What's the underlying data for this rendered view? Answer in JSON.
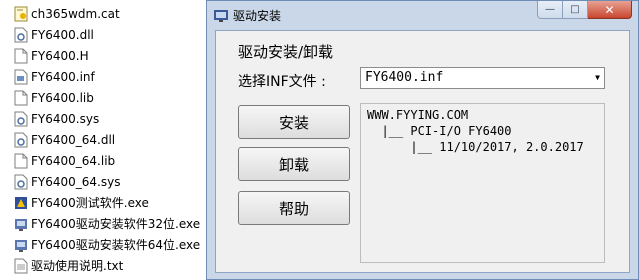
{
  "explorer": {
    "files": [
      {
        "name": "ch365wdm.cat",
        "icon": "certificate-file-icon"
      },
      {
        "name": "FY6400.dll",
        "icon": "dll-file-icon"
      },
      {
        "name": "FY6400.H",
        "icon": "blank-file-icon"
      },
      {
        "name": "FY6400.inf",
        "icon": "inf-file-icon"
      },
      {
        "name": "FY6400.lib",
        "icon": "blank-file-icon"
      },
      {
        "name": "FY6400.sys",
        "icon": "sys-file-icon"
      },
      {
        "name": "FY6400_64.dll",
        "icon": "dll-file-icon"
      },
      {
        "name": "FY6400_64.lib",
        "icon": "blank-file-icon"
      },
      {
        "name": "FY6400_64.sys",
        "icon": "sys-file-icon"
      },
      {
        "name": "FY6400测试软件.exe",
        "icon": "exe-app-icon"
      },
      {
        "name": "FY6400驱动安装软件32位.exe",
        "icon": "exe-setup-icon"
      },
      {
        "name": "FY6400驱动安装软件64位.exe",
        "icon": "exe-setup-icon"
      },
      {
        "name": "驱动使用说明.txt",
        "icon": "text-file-icon"
      }
    ]
  },
  "dialog": {
    "title": "驱动安装",
    "section_title": "驱动安装/卸载",
    "inf_label": "选择INF文件 :",
    "inf_value": "FY6400.inf",
    "buttons": {
      "install": "安装",
      "uninstall": "卸载",
      "help": "帮助"
    },
    "info_lines": [
      "WWW.FYYING.COM",
      "  |__ PCI-I/O FY6400",
      "      |__ 11/10/2017, 2.0.2017"
    ],
    "caption": {
      "minimize": "—",
      "maximize": "□",
      "close": "✕"
    }
  },
  "colors": {
    "frame": "#c9d7e8",
    "client": "#f0f0f0",
    "close_button": "#c8462f"
  }
}
